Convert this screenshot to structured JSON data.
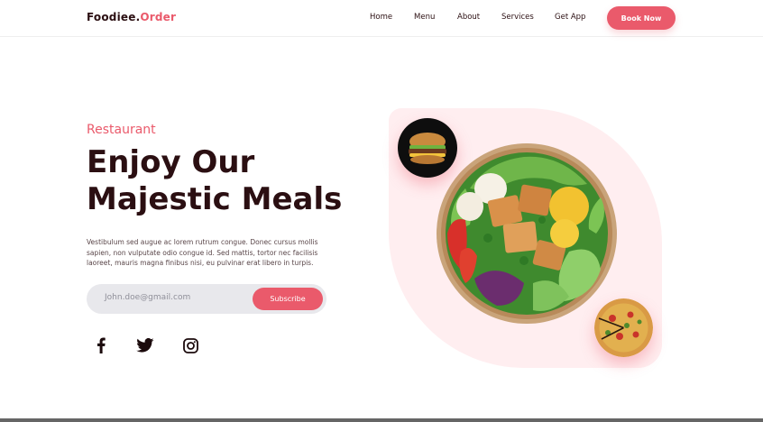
{
  "header": {
    "logo_brand": "Foodiee.",
    "logo_accent": "Order",
    "nav": [
      "Home",
      "Menu",
      "About",
      "Services",
      "Get App"
    ],
    "book_button": "Book Now"
  },
  "hero": {
    "eyebrow": "Restaurant",
    "headline_line1": "Enjoy Our",
    "headline_line2": "Majestic Meals",
    "description": "Vestibulum sed augue ac lorem rutrum congue. Donec cursus mollis sapien, non vulputate odio congue id. Sed mattis, tortor nec facilisis laoreet, mauris magna finibus nisi, eu pulvinar erat libero in turpis.",
    "subscribe": {
      "placeholder": "John.doe@gmail.com",
      "button": "Subscribe"
    },
    "socials": [
      "facebook-icon",
      "twitter-icon",
      "instagram-icon"
    ]
  },
  "colors": {
    "accent": "#ea5a6b",
    "text_dark": "#2b0f12",
    "blob": "#ffeef0",
    "input_bg": "#e8e8ec"
  }
}
